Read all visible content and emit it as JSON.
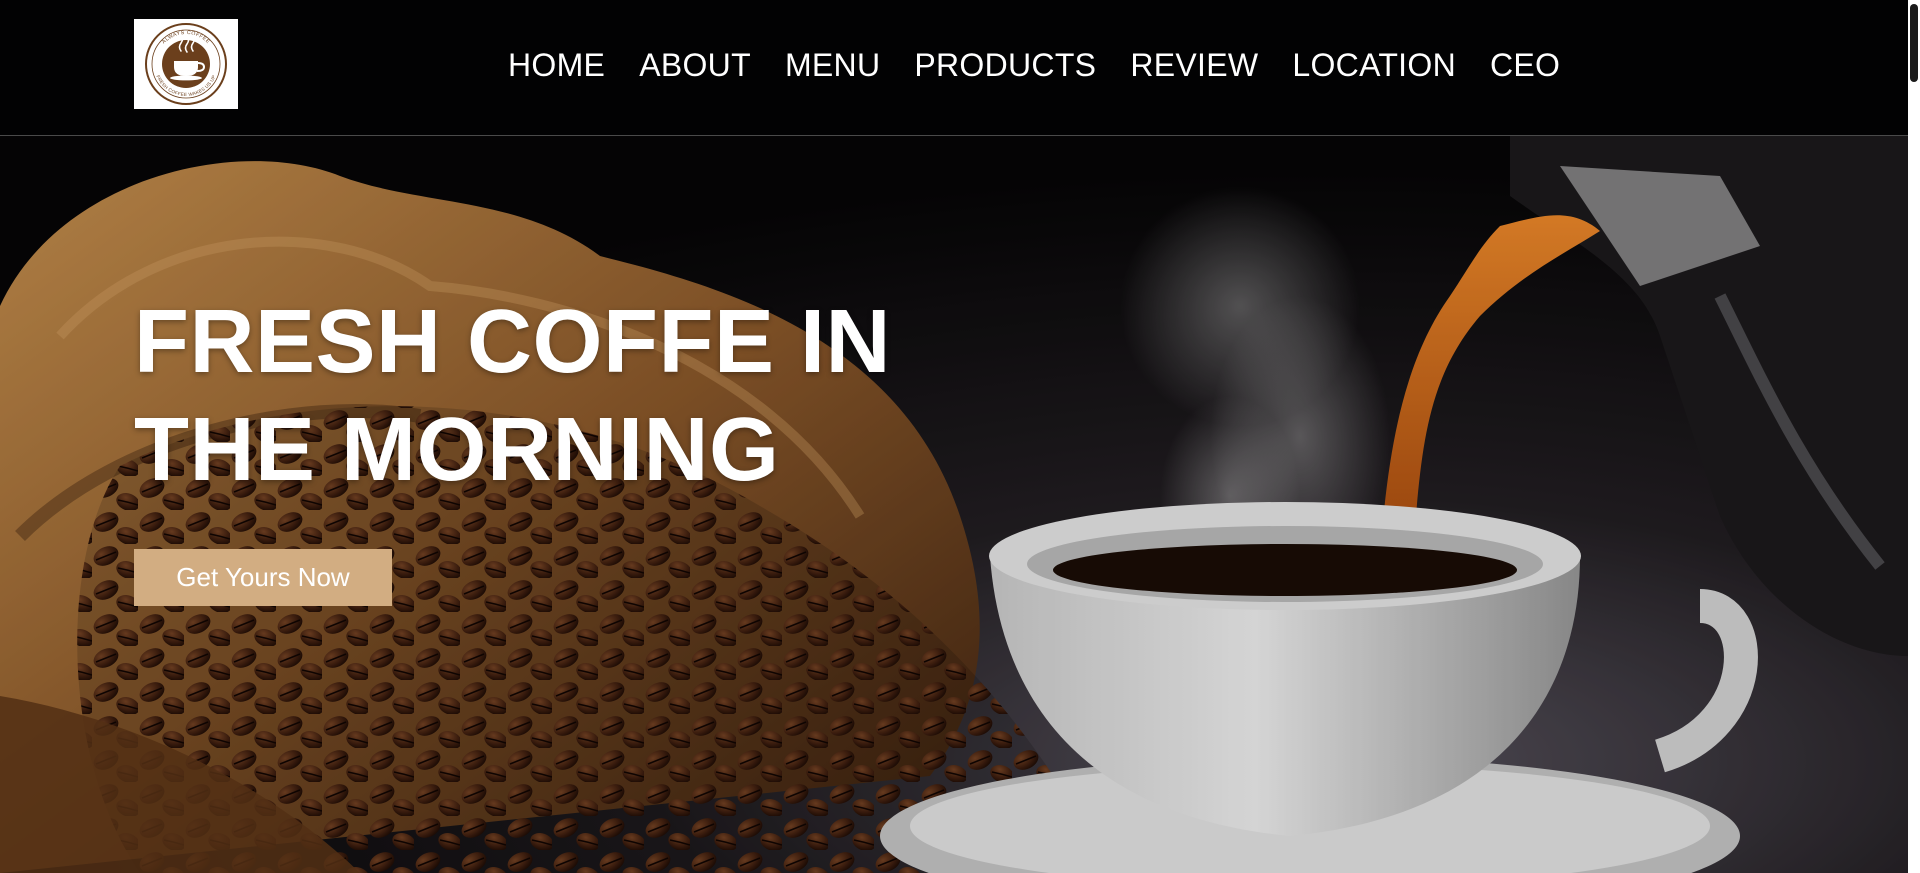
{
  "brand": {
    "logo_ring_top": "ALWAYS COFFEE",
    "logo_ring_bottom": "FRESH COFFEE WAKES US UP",
    "logo_icon": "steaming-cup-icon",
    "brand_color": "#6b3f1c"
  },
  "nav": {
    "items": [
      {
        "label": "HOME"
      },
      {
        "label": "ABOUT"
      },
      {
        "label": "MENU"
      },
      {
        "label": "PRODUCTS"
      },
      {
        "label": "REVIEW"
      },
      {
        "label": "LOCATION"
      },
      {
        "label": "CEO"
      }
    ]
  },
  "hero": {
    "title": "FRESH COFFE IN THE MORNING",
    "cta_label": "Get Yours Now",
    "cta_color": "#d2ad82",
    "background_description_icons": [
      "coffee-beans-sack-icon",
      "coffee-cup-icon",
      "coffee-pot-icon"
    ]
  },
  "colors": {
    "header_bg": "#020203",
    "text": "#ffffff"
  }
}
